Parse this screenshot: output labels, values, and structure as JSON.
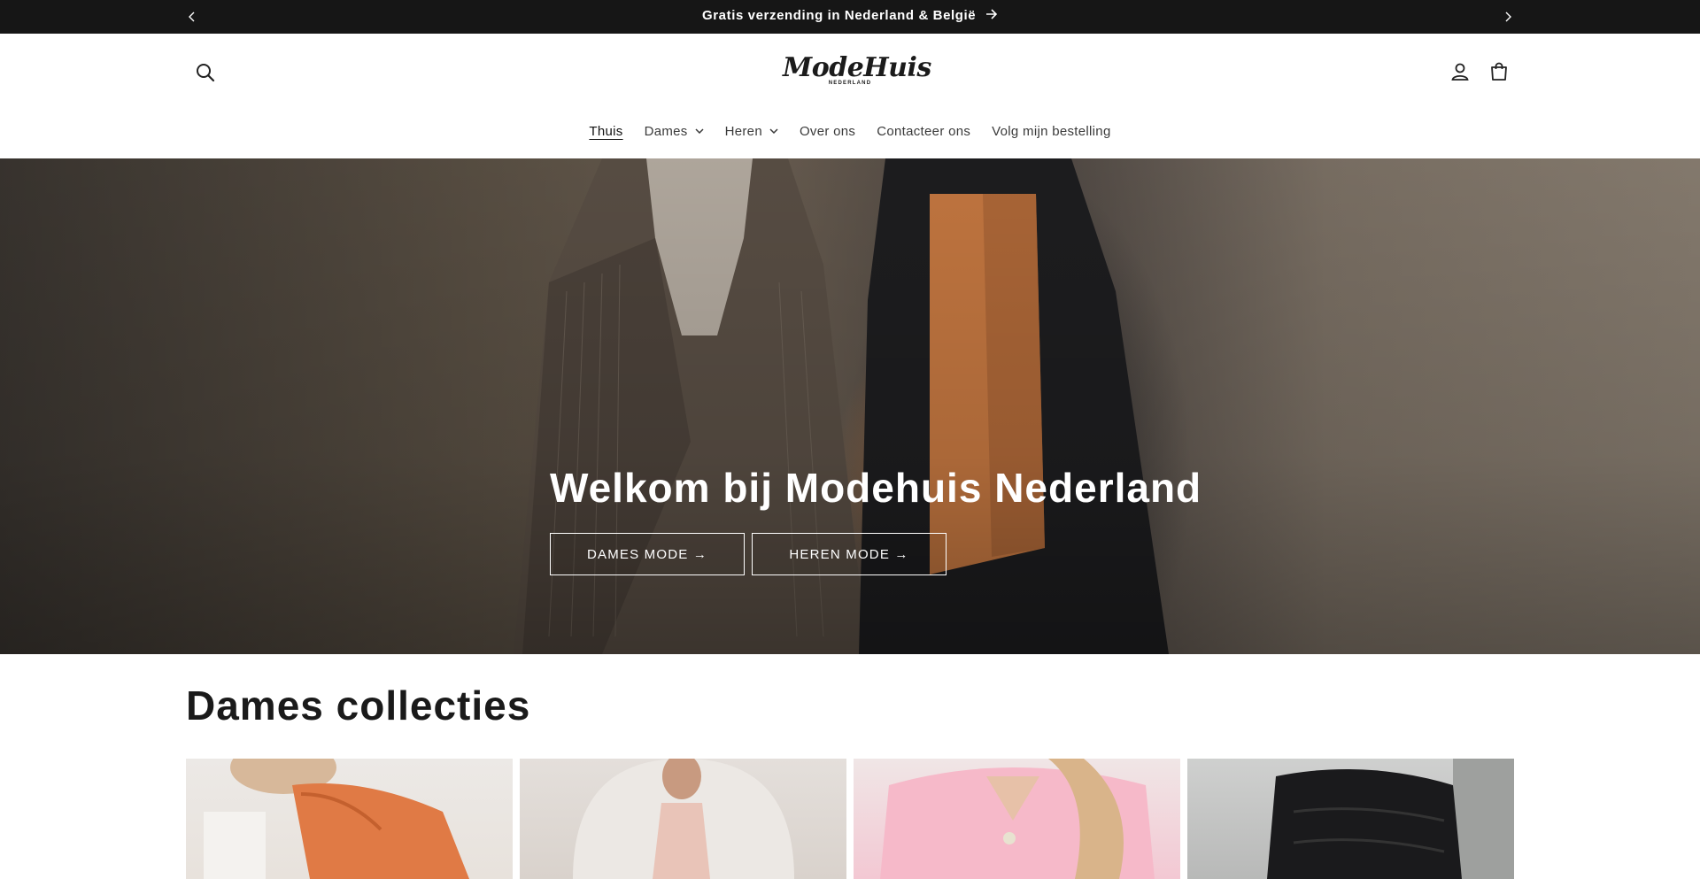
{
  "announcement": {
    "text": "Gratis verzending in Nederland & België",
    "prev_icon": "chevron-left-icon",
    "next_icon": "chevron-right-icon"
  },
  "header": {
    "logo_main": "ModeHuis",
    "logo_sub": "NEDERLAND",
    "icons": [
      "search-icon",
      "account-icon",
      "cart-icon"
    ]
  },
  "nav": {
    "items": [
      {
        "label": "Thuis",
        "active": true,
        "dropdown": false
      },
      {
        "label": "Dames",
        "active": false,
        "dropdown": true
      },
      {
        "label": "Heren",
        "active": false,
        "dropdown": true
      },
      {
        "label": "Over ons",
        "active": false,
        "dropdown": false
      },
      {
        "label": "Contacteer ons",
        "active": false,
        "dropdown": false
      },
      {
        "label": "Volg mijn bestelling",
        "active": false,
        "dropdown": false
      }
    ]
  },
  "hero": {
    "title_prefix": "Welkom bij",
    "title_strong": "Modehuis Nederland",
    "button_dames": "DAMES MODE →",
    "button_heren": "HEREN MODE →"
  },
  "collections": {
    "title": "Dames collecties"
  },
  "colors": {
    "announcement_bg": "#161616",
    "text_dark": "#1a1a1a",
    "hero_text": "#ffffff"
  }
}
